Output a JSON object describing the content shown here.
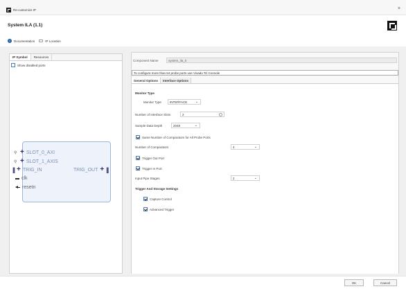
{
  "window": {
    "title": "Re-customize IP",
    "close_glyph": "×"
  },
  "header": {
    "ip_title": "System ILA (1.1)",
    "documentation": "Documentation",
    "ip_location": "IP Location"
  },
  "left_panel": {
    "tabs": [
      "IP Symbol",
      "Resources"
    ],
    "show_disabled_ports": "Show disabled ports",
    "symbol": {
      "ports_left": [
        "SLOT_0_AXI",
        "SLOT_1_AXIS",
        "TRIG_IN",
        "clk",
        "resetn"
      ],
      "port_right": "TRIG_OUT"
    }
  },
  "right_panel": {
    "component_name_label": "Component Name",
    "component_name_value": "system_ila_0",
    "notice": "To configure more than 64 probe ports use Vivado Tcl Console",
    "tabs": [
      "General Options",
      "Interface Options"
    ],
    "monitor_type_section": "Monitor Type",
    "monitor_type_label": "Monitor Type",
    "monitor_type_value": "INTERFACE",
    "num_slots_label": "Number of Interface Slots",
    "num_slots_value": "2",
    "depth_label": "Sample Data Depth",
    "depth_value": "2048",
    "same_comparators_label": "Same Number of Comparators for All Probe Ports",
    "num_comparators_label": "Number of Comparators",
    "num_comparators_value": "4",
    "trigger_out_label": "Trigger Out Port",
    "trigger_in_label": "Trigger In Port",
    "pipe_stages_label": "Input Pipe Stages",
    "pipe_stages_value": "2",
    "trigger_storage_section": "Trigger And Storage Settings",
    "capture_control_label": "Capture Control",
    "advanced_trigger_label": "Advanced Trigger"
  },
  "footer": {
    "ok_label": "OK",
    "cancel_label": "Cancel"
  }
}
